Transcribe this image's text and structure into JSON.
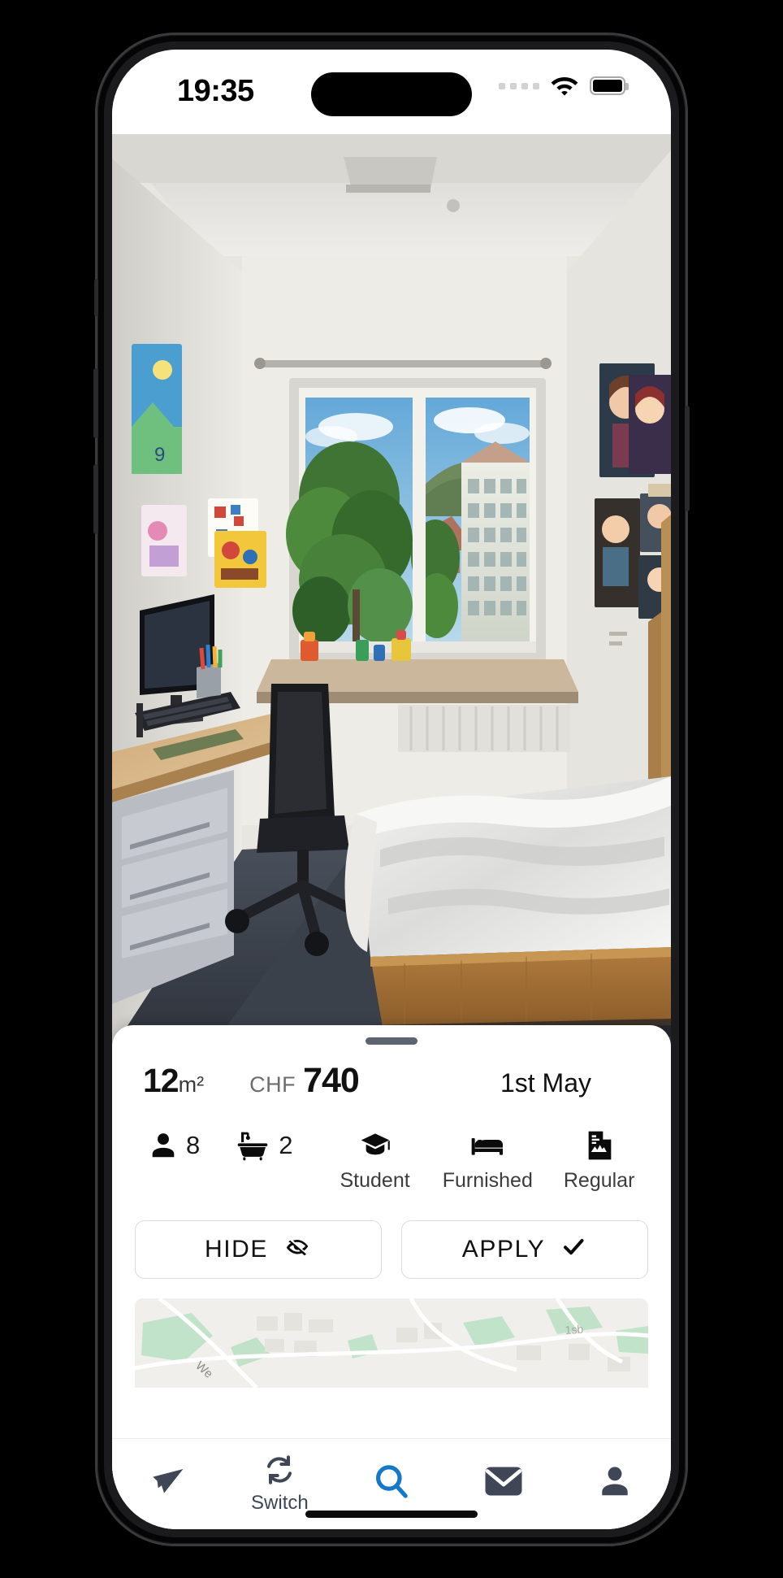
{
  "status_bar": {
    "time": "19:35",
    "signal_icon": "signal-dots-icon",
    "wifi_icon": "wifi-icon",
    "battery_icon": "battery-full-icon"
  },
  "listing_photo": {
    "alt": "student-room-photo",
    "description": "Student dorm room with desk, office chair, window view of trees and apartment building, single bed with white duvet, posters on wall"
  },
  "sheet": {
    "grabber": "drag-handle",
    "size_value": "12",
    "size_unit": "m²",
    "currency": "CHF",
    "price": "740",
    "available_from": "1st May",
    "amenities": [
      {
        "icon": "person-icon",
        "value": "8",
        "label": ""
      },
      {
        "icon": "bathtub-icon",
        "value": "2",
        "label": ""
      },
      {
        "icon": "graduation-cap-icon",
        "value": "",
        "label": "Student"
      },
      {
        "icon": "bed-icon",
        "value": "",
        "label": "Furnished"
      },
      {
        "icon": "document-contract-icon",
        "value": "",
        "label": "Regular"
      }
    ],
    "hide_button": {
      "label": "HIDE",
      "icon": "eye-off-icon"
    },
    "apply_button": {
      "label": "APPLY",
      "icon": "check-icon"
    },
    "map_preview": "map-preview"
  },
  "bottom_nav": {
    "items": [
      {
        "name": "flights",
        "icon": "airplane-icon",
        "label": "",
        "active": false
      },
      {
        "name": "switch",
        "icon": "refresh-switch-icon",
        "label": "Switch",
        "active": false
      },
      {
        "name": "search",
        "icon": "search-icon",
        "label": "",
        "active": true
      },
      {
        "name": "messages",
        "icon": "envelope-icon",
        "label": "",
        "active": false
      },
      {
        "name": "profile",
        "icon": "person-icon",
        "label": "",
        "active": false
      }
    ]
  },
  "colors": {
    "accent_blue": "#1578c8",
    "nav_icon": "#3f4756",
    "grabber": "#5c6472",
    "text_primary": "#111111",
    "text_muted": "#6d6d6d"
  }
}
